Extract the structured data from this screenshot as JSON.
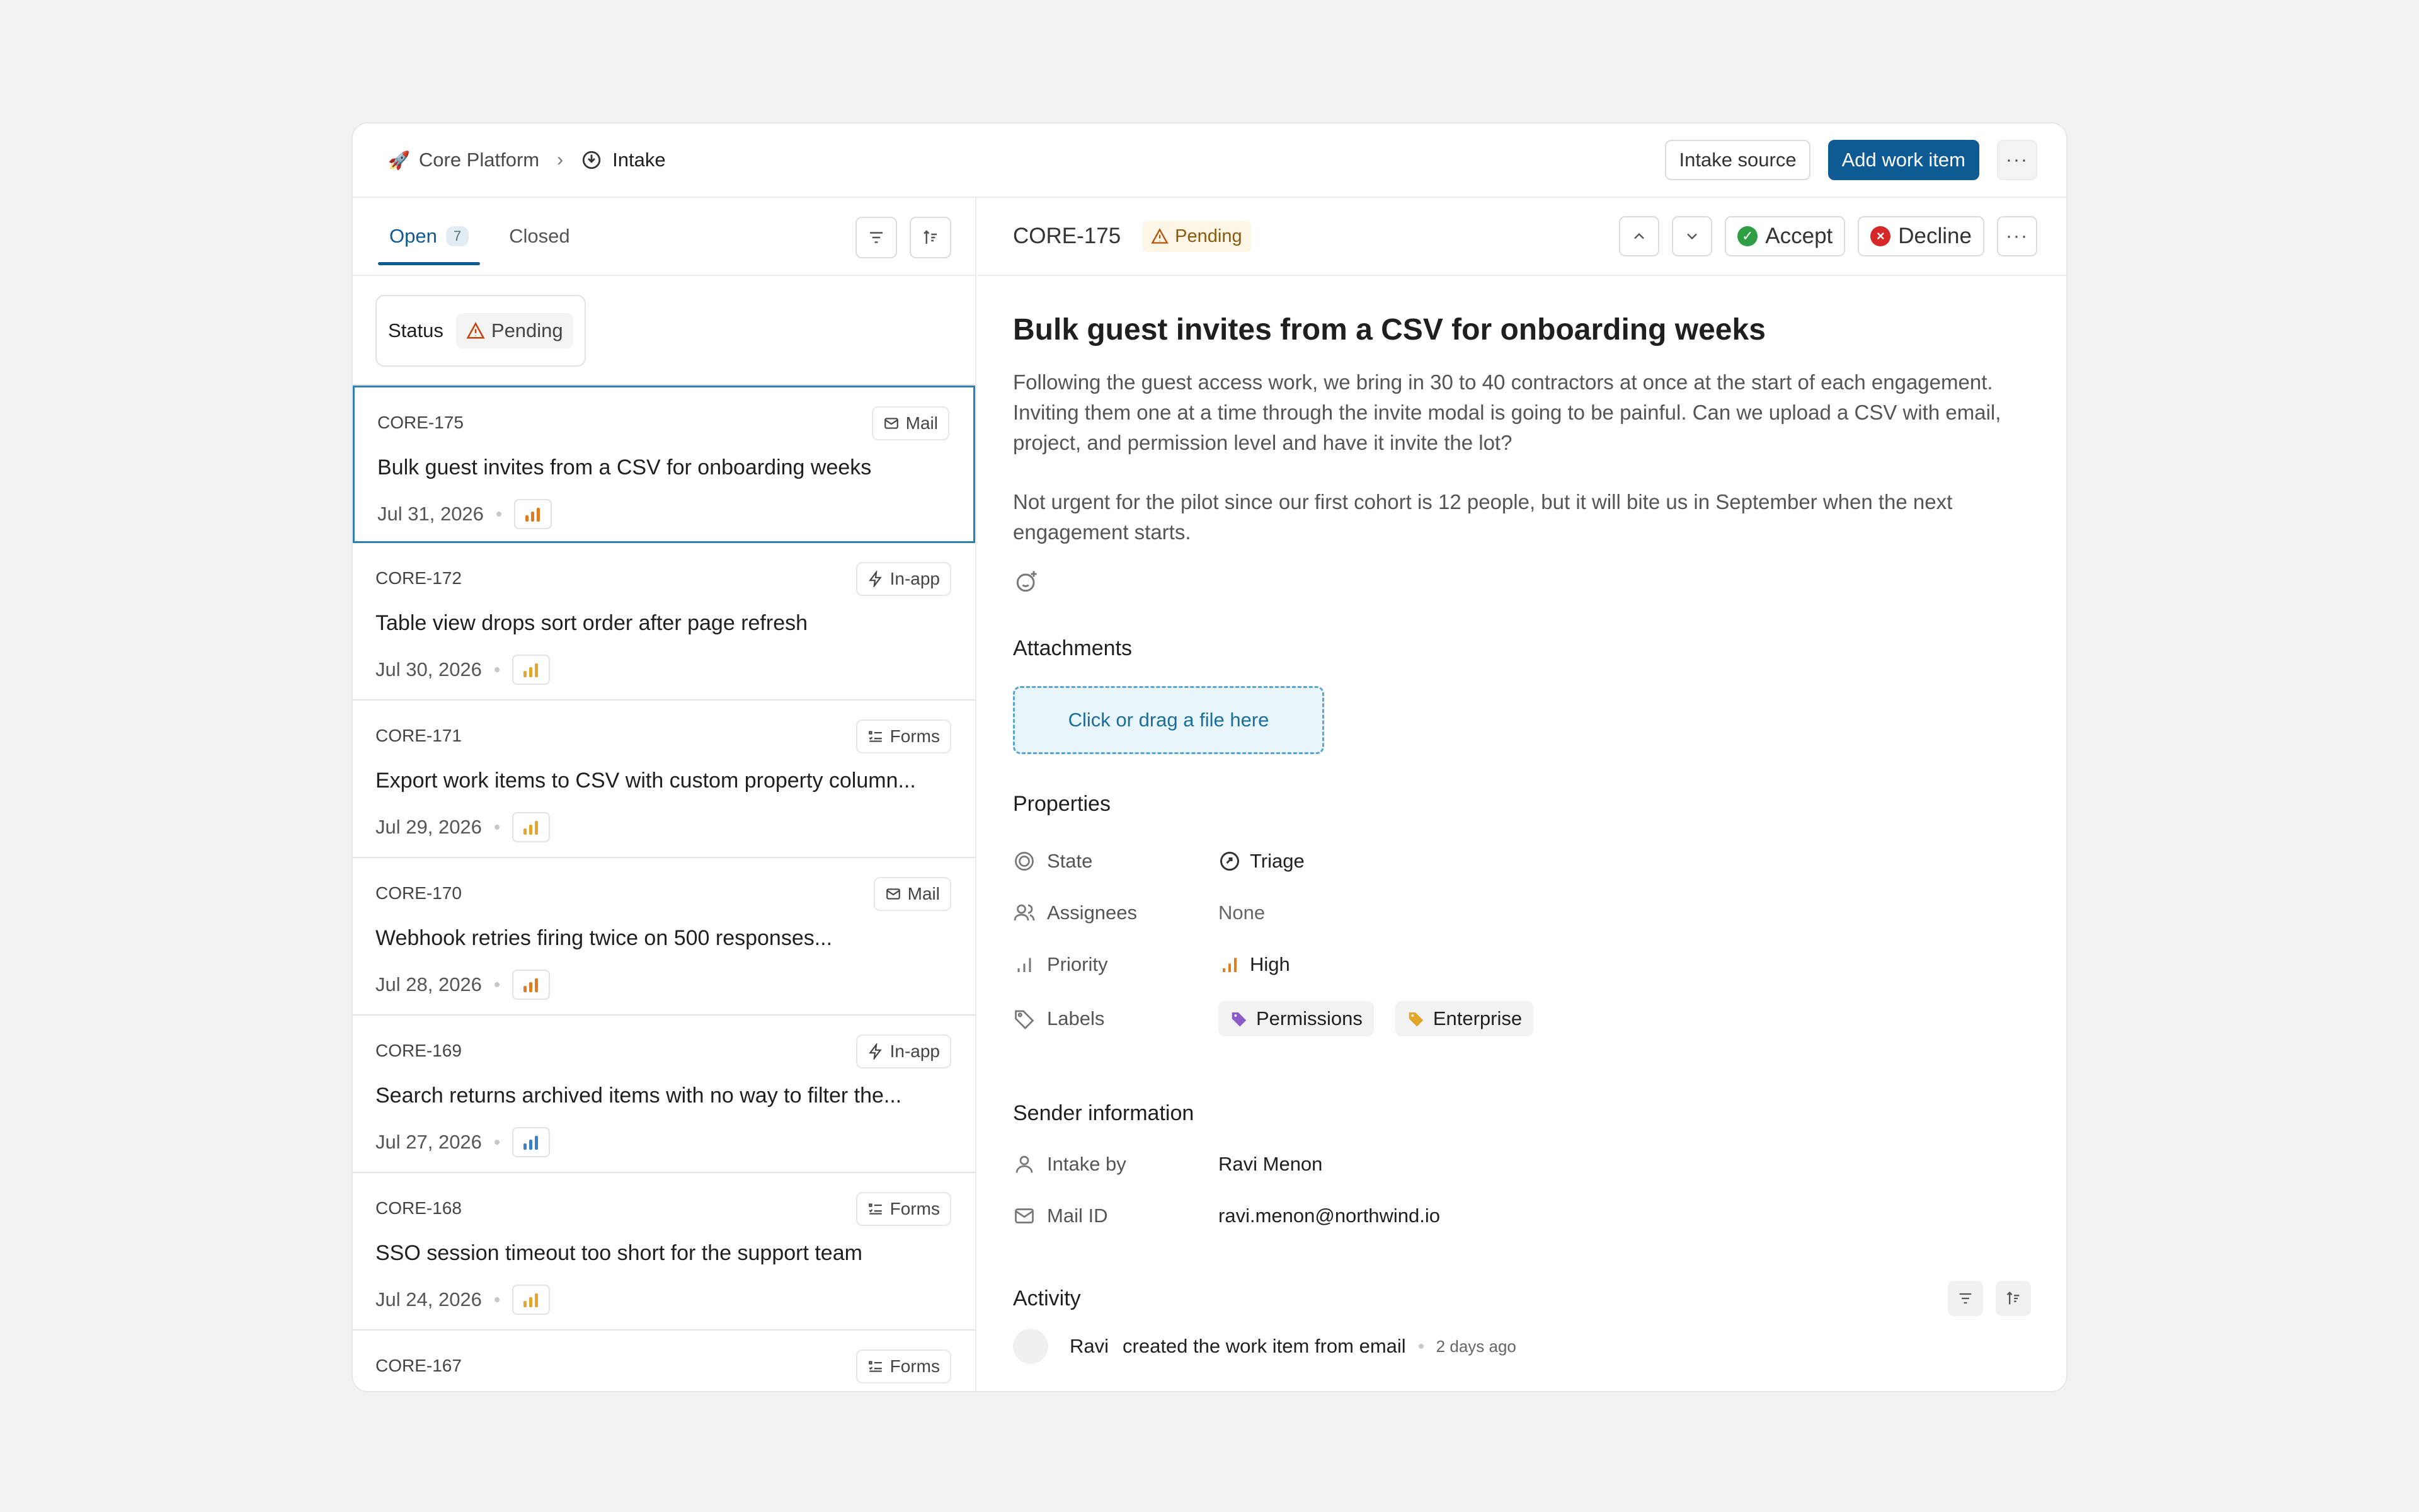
{
  "breadcrumb": {
    "project": "Core Platform",
    "page": "Intake"
  },
  "header": {
    "intake_source": "Intake source",
    "add_work_item": "Add work item"
  },
  "tabs": [
    {
      "label": "Open",
      "count": "7"
    },
    {
      "label": "Closed"
    }
  ],
  "filter": {
    "key": "Status",
    "value": "Pending"
  },
  "items": [
    {
      "id": "CORE-175",
      "source": "Mail",
      "title": "Bulk guest invites from a CSV for onboarding weeks",
      "date": "Jul 31, 2026",
      "priority": "high"
    },
    {
      "id": "CORE-172",
      "source": "In-app",
      "title": "Table view drops sort order after page refresh",
      "date": "Jul 30, 2026",
      "priority": "medium"
    },
    {
      "id": "CORE-171",
      "source": "Forms",
      "title": "Export work items to CSV with custom property column...",
      "date": "Jul 29, 2026",
      "priority": "medium"
    },
    {
      "id": "CORE-170",
      "source": "Mail",
      "title": "Webhook retries firing twice on 500 responses...",
      "date": "Jul 28, 2026",
      "priority": "high"
    },
    {
      "id": "CORE-169",
      "source": "In-app",
      "title": "Search returns archived items with no way to filter the...",
      "date": "Jul 27, 2026",
      "priority": "low"
    },
    {
      "id": "CORE-168",
      "source": "Forms",
      "title": "SSO session timeout too short for the support team",
      "date": "Jul 24, 2026",
      "priority": "medium"
    },
    {
      "id": "CORE-167",
      "source": "Forms",
      "title": "",
      "date": "",
      "priority": ""
    }
  ],
  "detail": {
    "id": "CORE-175",
    "status": "Pending",
    "accept": "Accept",
    "decline": "Decline",
    "title": "Bulk guest invites from a CSV for onboarding weeks",
    "para1": "Following the guest access work, we bring in 30 to 40 contractors at once at the start of each engagement. Inviting them one at a time through the invite modal is going to be painful. Can we upload a CSV with email, project, and permission level and have it invite the lot?",
    "para2": "Not urgent for the pilot since our first cohort is 12 people, but it will bite us in September when the next engagement starts.",
    "attachments_title": "Attachments",
    "dropzone": "Click or drag a file here",
    "properties_title": "Properties",
    "properties": {
      "state_label": "State",
      "state_value": "Triage",
      "assignees_label": "Assignees",
      "assignees_value": "None",
      "priority_label": "Priority",
      "priority_value": "High",
      "labels_label": "Labels",
      "labels": [
        "Permissions",
        "Enterprise"
      ]
    },
    "sender_title": "Sender information",
    "sender": {
      "intake_by_label": "Intake by",
      "intake_by_value": "Ravi Menon",
      "mail_label": "Mail ID",
      "mail_value": "ravi.menon@northwind.io"
    },
    "activity_title": "Activity",
    "activity": {
      "who": "Ravi",
      "text": "created the work item from email",
      "time": "2 days ago"
    }
  },
  "colors": {
    "accent": "#0e5a92",
    "priority_high": "#e07b1f",
    "priority_medium": "#e3a62a",
    "priority_low": "#3b82c4",
    "label_permissions": "#8b5cc7",
    "label_enterprise": "#e3a62a",
    "accept": "#2f9e44",
    "decline": "#d62828"
  },
  "icons": [
    "rocket-icon",
    "intake-icon",
    "chevron-right-icon",
    "filter-icon",
    "sort-icon",
    "warning-icon",
    "mail-icon",
    "bolt-icon",
    "forms-icon",
    "chevron-up-icon",
    "chevron-down-icon",
    "check-circle-icon",
    "x-circle-icon",
    "more-icon",
    "emoji-icon",
    "state-icon",
    "triage-icon",
    "user-icon",
    "priority-icon",
    "tag-icon",
    "mail-id-icon"
  ]
}
